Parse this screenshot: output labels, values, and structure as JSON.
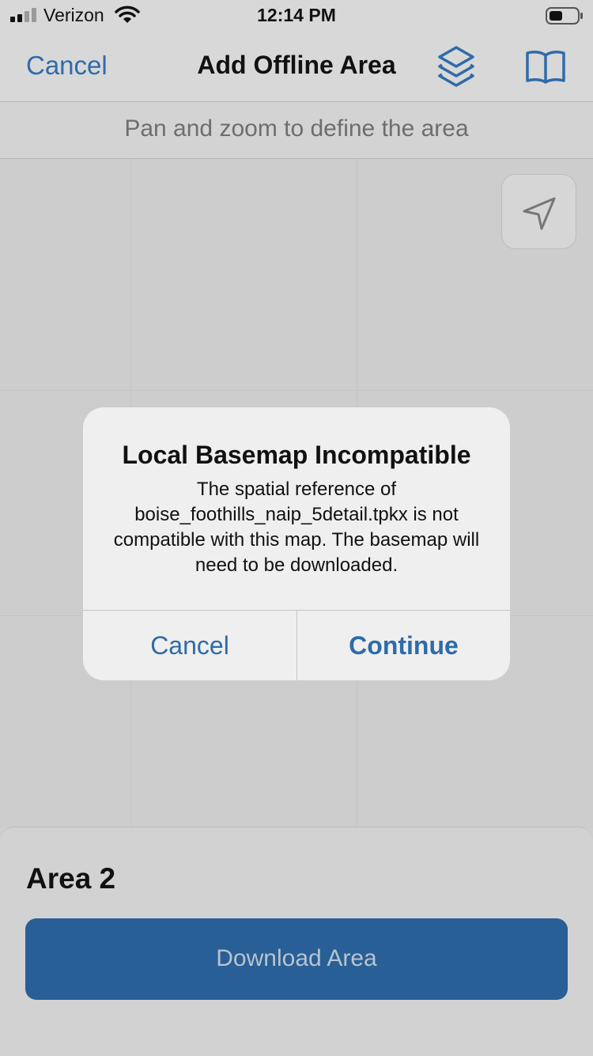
{
  "status_bar": {
    "carrier": "Verizon",
    "time": "12:14 PM",
    "signal_bars_filled": 2,
    "signal_bars_total": 4
  },
  "nav_bar": {
    "cancel_label": "Cancel",
    "title": "Add Offline Area",
    "icons": [
      "layers-icon",
      "book-icon"
    ]
  },
  "instruction": "Pan and zoom to define the area",
  "map": {
    "locate_icon": "location-arrow-icon"
  },
  "alert": {
    "title": "Local Basemap Incompatible",
    "message": "The spatial reference of boise_foothills_naip_5detail.tpkx is not compatible with this map. The basemap will need to be downloaded.",
    "cancel_label": "Cancel",
    "continue_label": "Continue"
  },
  "bottom_panel": {
    "area_name": "Area 2",
    "download_label": "Download Area"
  },
  "colors": {
    "accent": "#2f6ba8",
    "download_button": "#285f96"
  }
}
